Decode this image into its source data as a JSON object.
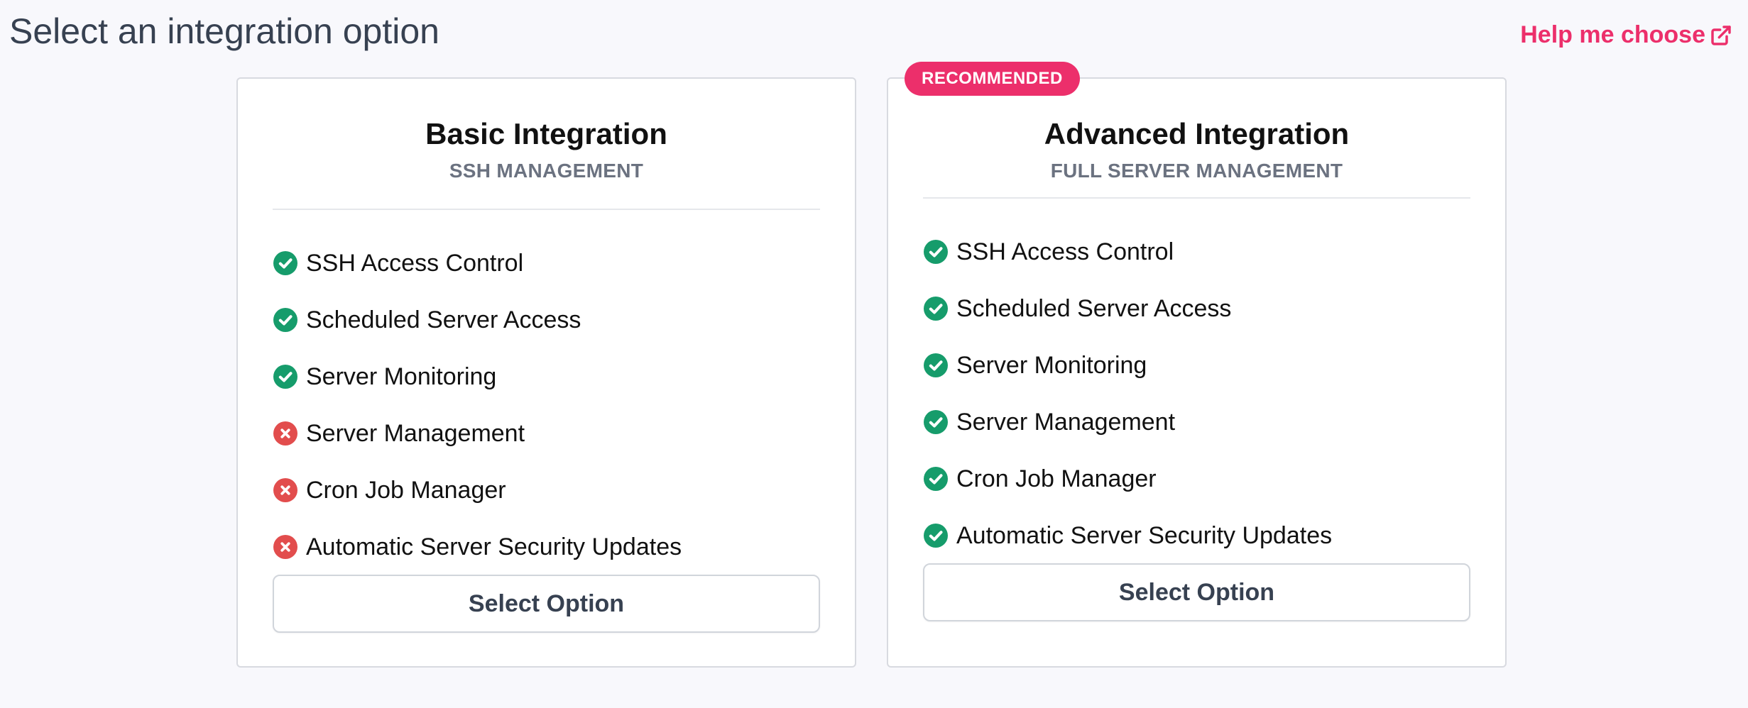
{
  "header": {
    "title": "Select an integration option",
    "help_link": "Help me choose",
    "help_icon": "external-link-icon"
  },
  "colors": {
    "accent": "#ec2f6b",
    "check": "#169c6b",
    "cross": "#e24d4d"
  },
  "plans": [
    {
      "title": "Basic Integration",
      "subtitle": "SSH MANAGEMENT",
      "badge": "",
      "button_label": "Select Option",
      "features": [
        {
          "label": "SSH Access Control",
          "included": true
        },
        {
          "label": "Scheduled Server Access",
          "included": true
        },
        {
          "label": "Server Monitoring",
          "included": true
        },
        {
          "label": "Server Management",
          "included": false
        },
        {
          "label": "Cron Job Manager",
          "included": false
        },
        {
          "label": "Automatic Server Security Updates",
          "included": false
        }
      ]
    },
    {
      "title": "Advanced Integration",
      "subtitle": "FULL SERVER MANAGEMENT",
      "badge": "RECOMMENDED",
      "button_label": "Select Option",
      "features": [
        {
          "label": "SSH Access Control",
          "included": true
        },
        {
          "label": "Scheduled Server Access",
          "included": true
        },
        {
          "label": "Server Monitoring",
          "included": true
        },
        {
          "label": "Server Management",
          "included": true
        },
        {
          "label": "Cron Job Manager",
          "included": true
        },
        {
          "label": "Automatic Server Security Updates",
          "included": true
        }
      ]
    }
  ]
}
